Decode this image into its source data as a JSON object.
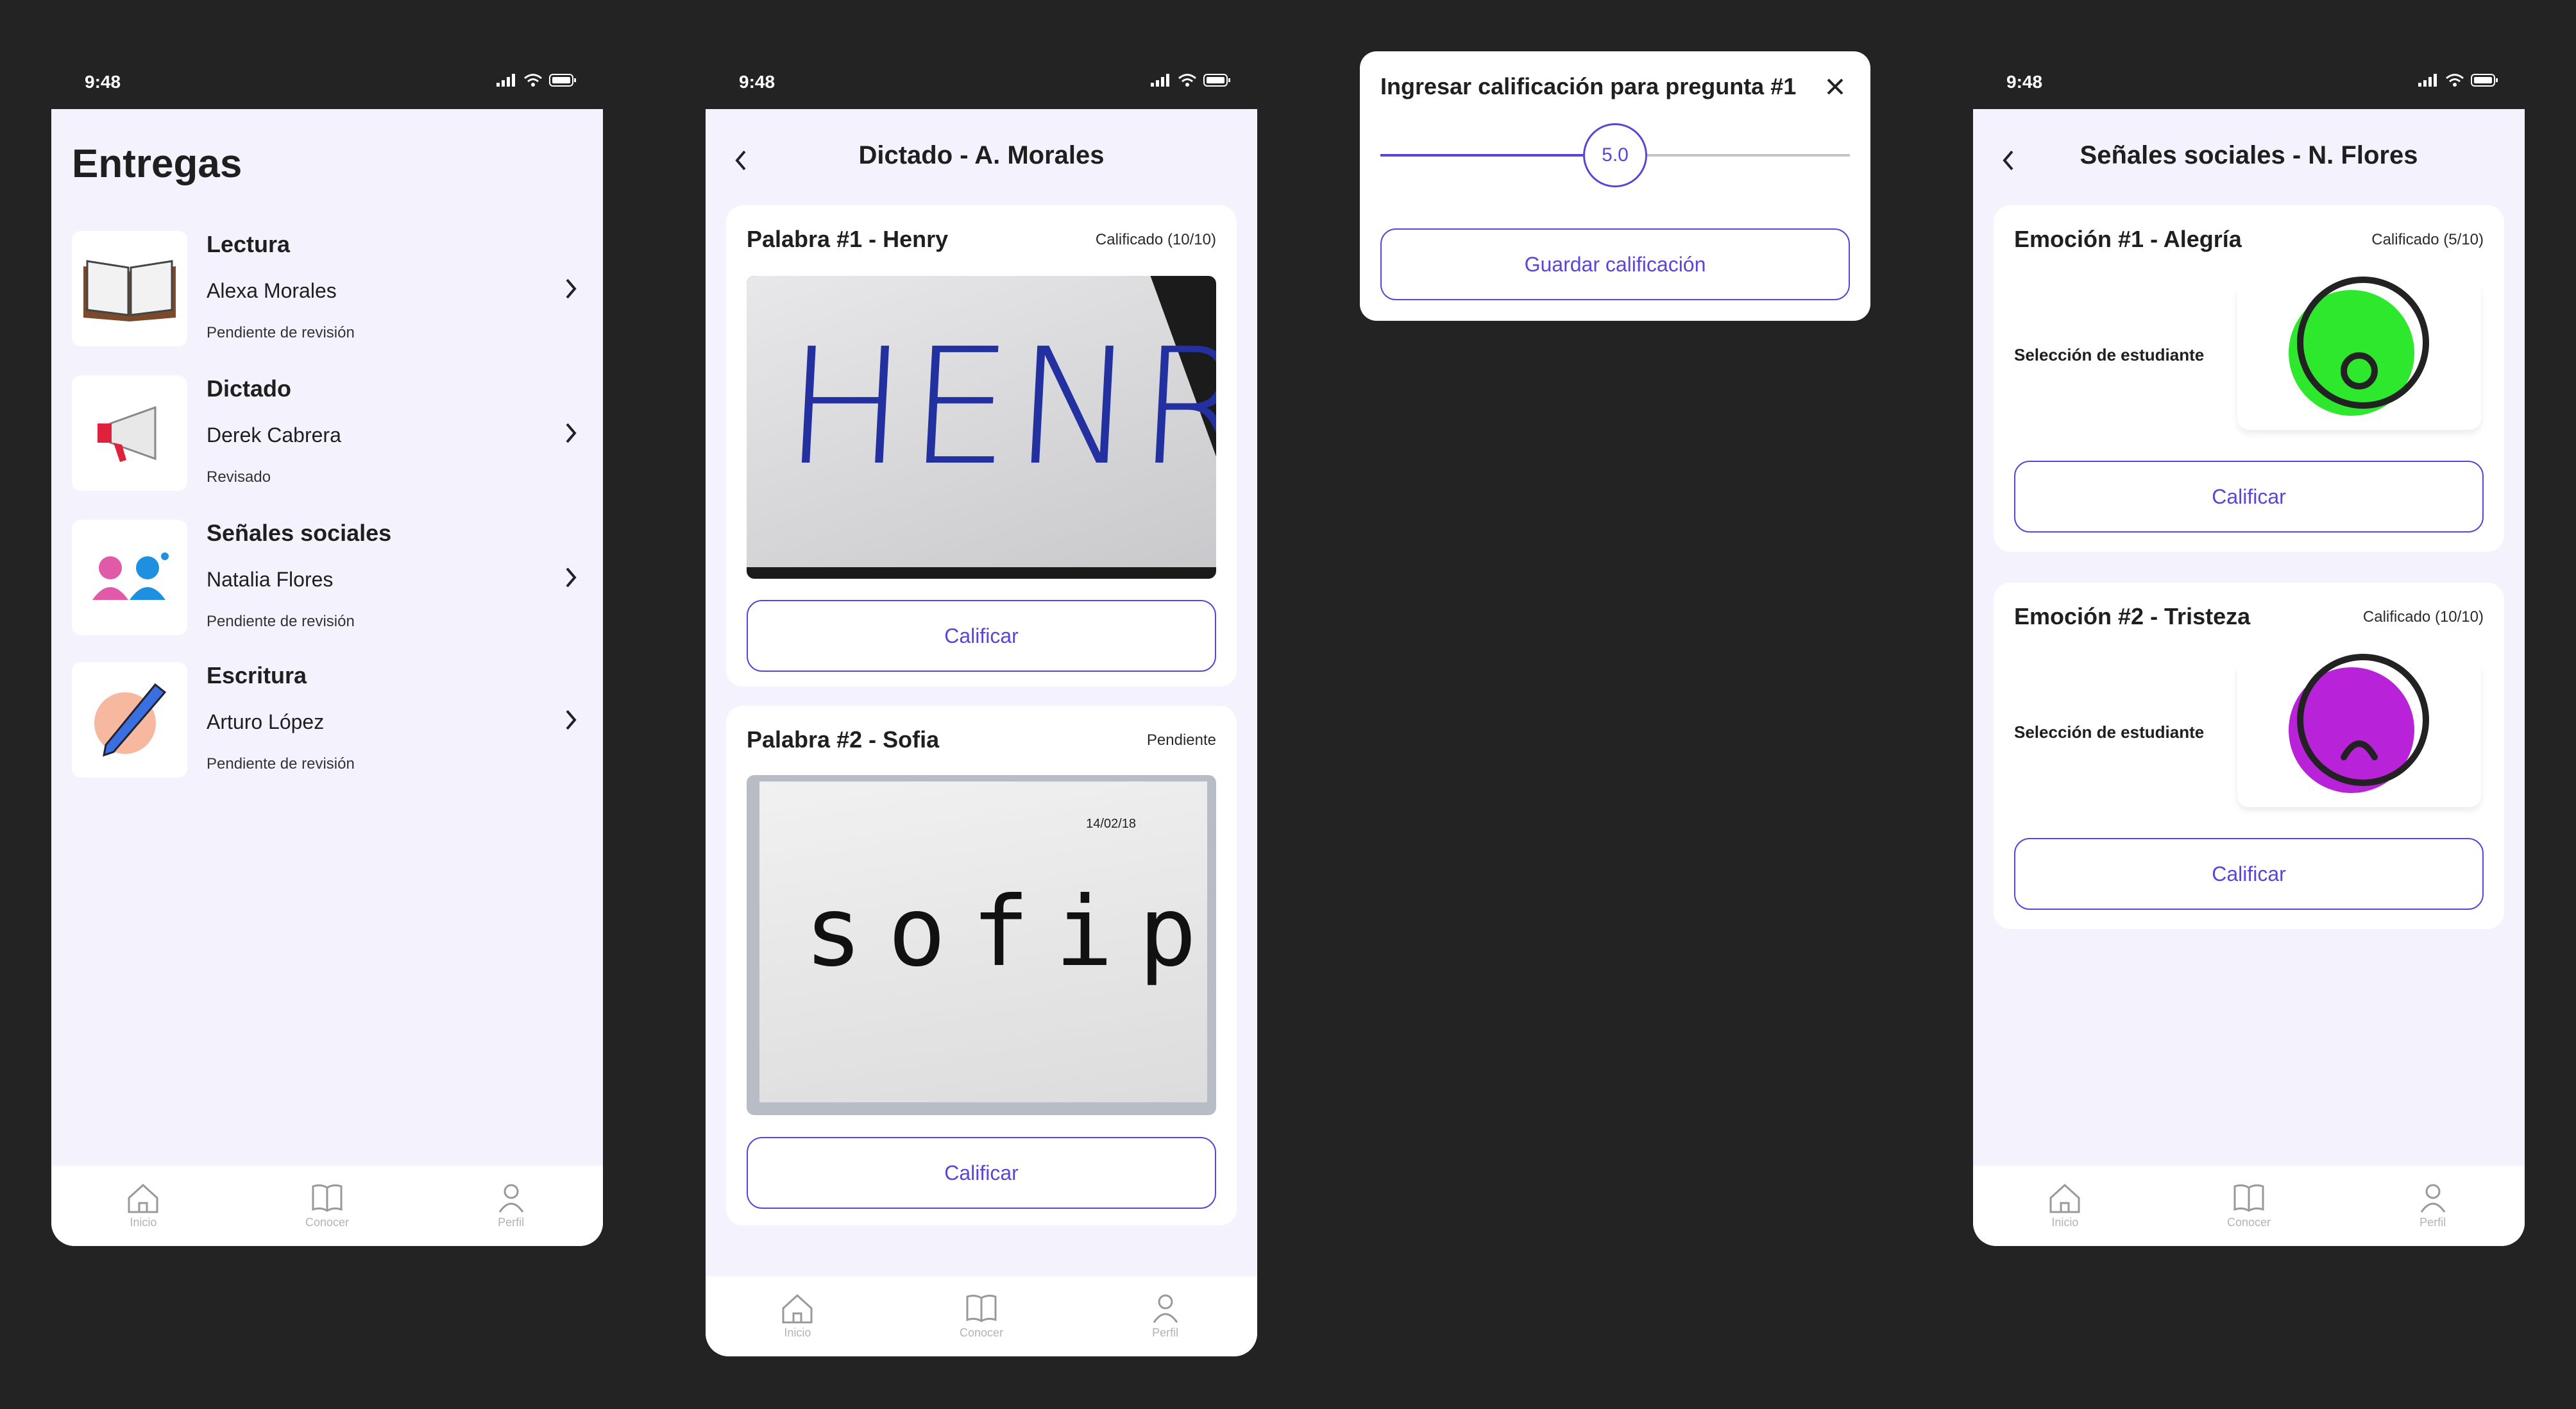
{
  "status_bar": {
    "time": "9:48"
  },
  "screen1": {
    "title": "Entregas",
    "items": [
      {
        "title": "Lectura",
        "name": "Alexa Morales",
        "status": "Pendiente de revisión",
        "icon": "book-icon"
      },
      {
        "title": "Dictado",
        "name": "Derek Cabrera",
        "status": "Revisado",
        "icon": "megaphone-icon"
      },
      {
        "title": "Señales sociales",
        "name": "Natalia Flores",
        "status": "Pendiente de revisión",
        "icon": "people-icon"
      },
      {
        "title": "Escritura",
        "name": "Arturo López",
        "status": "Pendiente de revisión",
        "icon": "pencil-icon"
      }
    ]
  },
  "tabbar": {
    "inicio": "Inicio",
    "conocer": "Conocer",
    "perfil": "Perfil"
  },
  "screen2": {
    "title": "Dictado - A. Morales",
    "cards": [
      {
        "title": "Palabra #1 - Henry",
        "badge": "Calificado (10/10)",
        "photo_text": "HENRY",
        "button": "Calificar"
      },
      {
        "title": "Palabra #2 - Sofia",
        "badge": "Pendiente",
        "photo_text": "sofip",
        "photo_date": "14/02/18",
        "button": "Calificar"
      }
    ]
  },
  "modal": {
    "title": "Ingresar calificación para pregunta #1",
    "slider_value": "5.0",
    "slider_fraction": 0.5,
    "button": "Guardar calificación"
  },
  "screen4": {
    "title": "Señales sociales - N. Flores",
    "cards": [
      {
        "title": "Emoción #1 - Alegría",
        "badge": "Calificado (5/10)",
        "label": "Selección de estudiante",
        "face_color": "#2ee82e",
        "mood": "happy-face-icon",
        "button": "Calificar"
      },
      {
        "title": "Emoción #2 - Tristeza",
        "badge": "Calificado (10/10)",
        "label": "Selección de estudiante",
        "face_color": "#b823d9",
        "mood": "sad-face-icon",
        "button": "Calificar"
      }
    ]
  },
  "colors": {
    "accent": "#5b45d9",
    "background": "#232323",
    "app_bg": "#f4f2fd"
  }
}
